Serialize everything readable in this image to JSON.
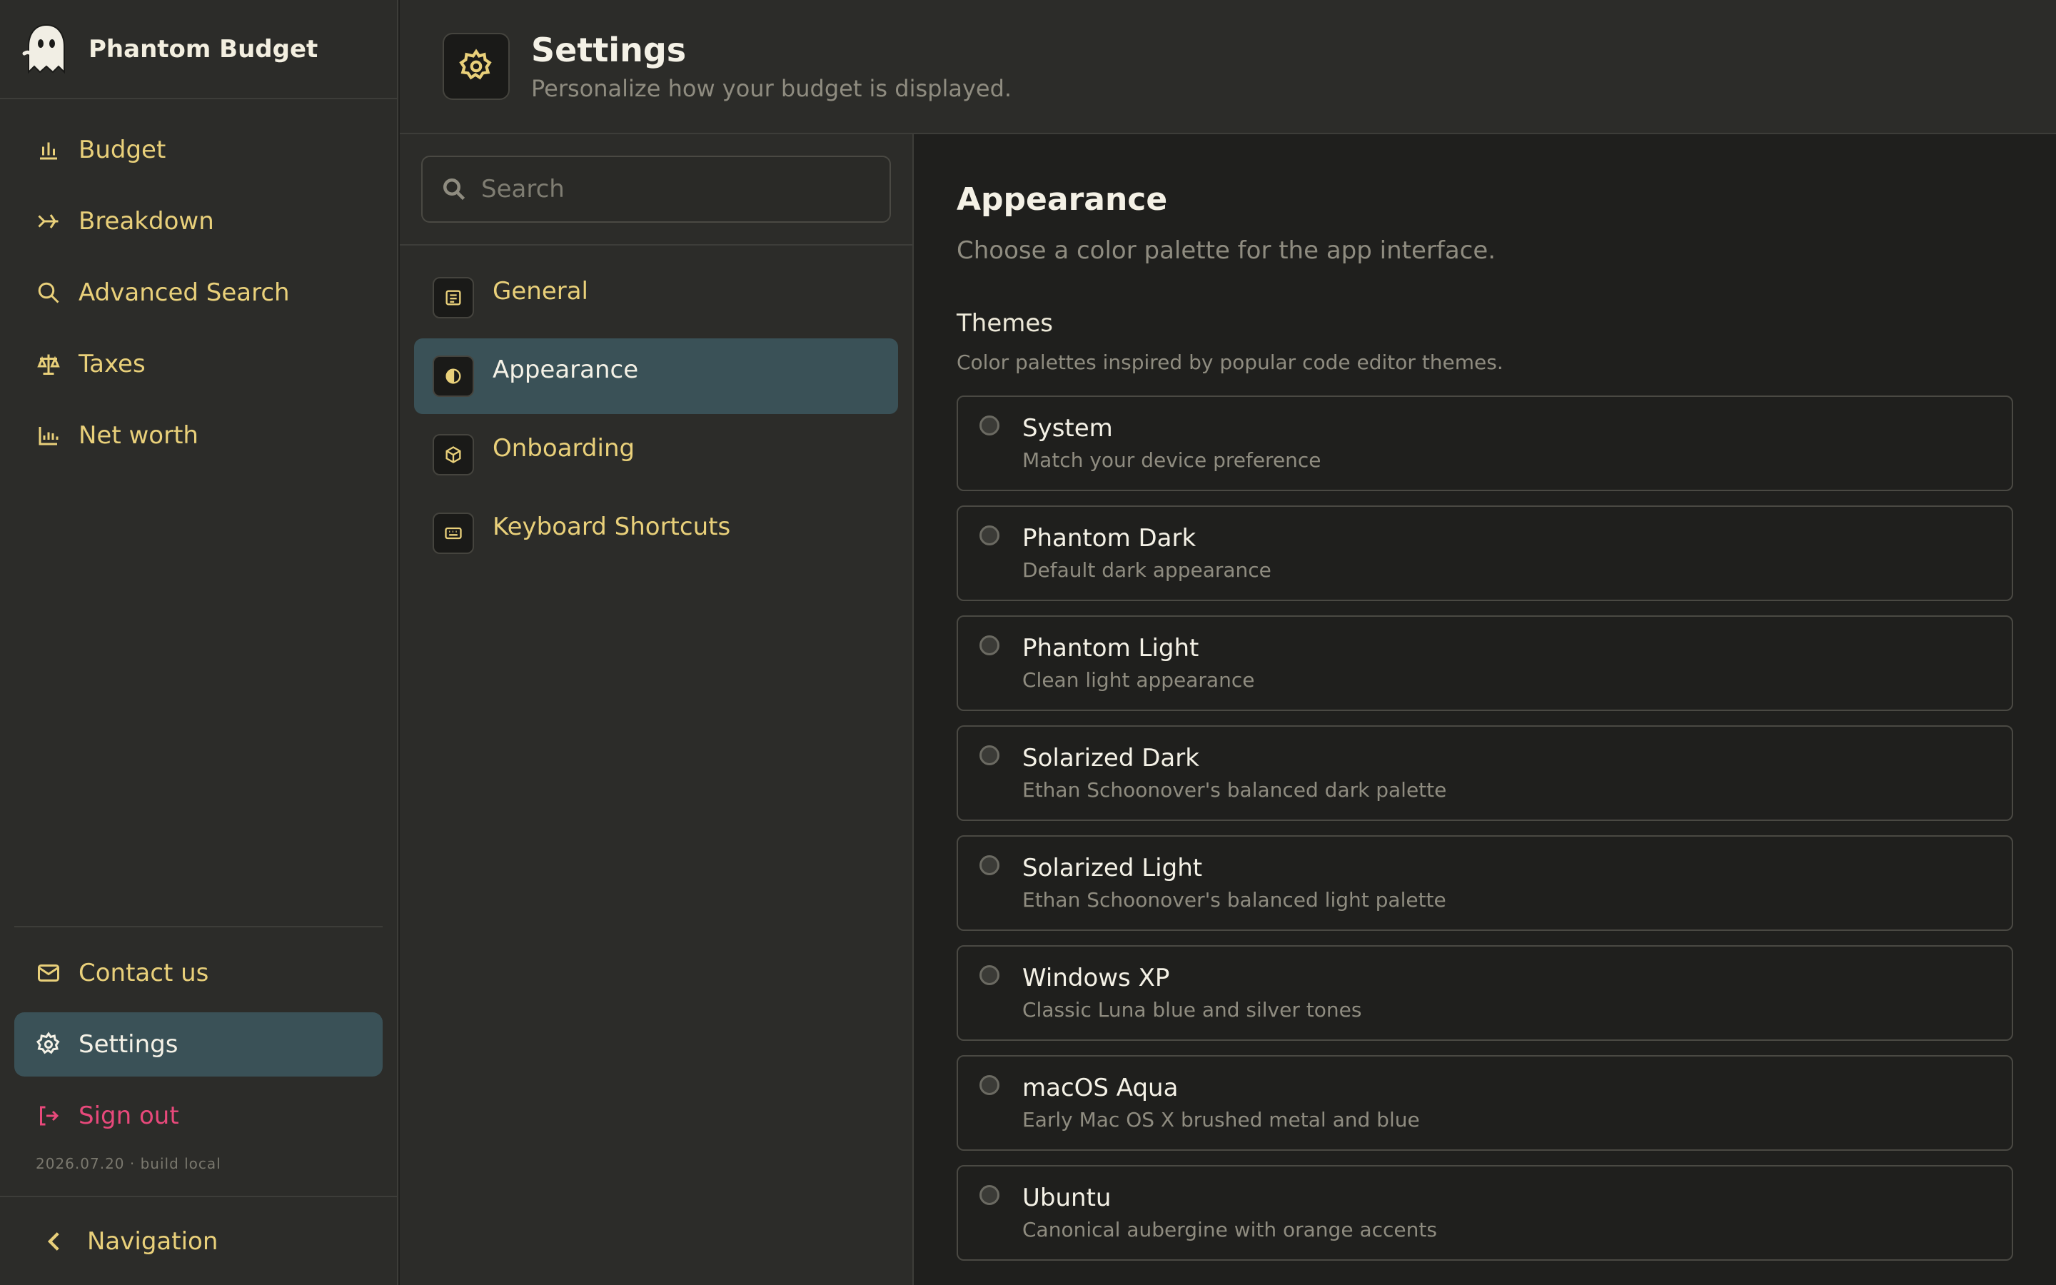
{
  "app": {
    "name": "Phantom Budget"
  },
  "sidebar": {
    "nav": [
      {
        "label": "Budget",
        "icon": "bar-chart-icon"
      },
      {
        "label": "Breakdown",
        "icon": "split-arrows-icon"
      },
      {
        "label": "Advanced Search",
        "icon": "search-icon"
      },
      {
        "label": "Taxes",
        "icon": "scale-icon"
      },
      {
        "label": "Net worth",
        "icon": "line-chart-icon"
      }
    ],
    "bottom": [
      {
        "label": "Contact us",
        "icon": "mail-icon"
      },
      {
        "label": "Settings",
        "icon": "gear-icon",
        "active": true
      },
      {
        "label": "Sign out",
        "icon": "sign-out-icon"
      }
    ],
    "build": "2026.07.20 · build local",
    "footer_label": "Navigation"
  },
  "header": {
    "title": "Settings",
    "subtitle": "Personalize how your budget is displayed."
  },
  "categories": {
    "search_placeholder": "Search",
    "items": [
      {
        "label": "General",
        "icon": "document-icon"
      },
      {
        "label": "Appearance",
        "icon": "half-circle-icon",
        "active": true
      },
      {
        "label": "Onboarding",
        "icon": "box-icon"
      },
      {
        "label": "Keyboard Shortcuts",
        "icon": "keyboard-icon"
      }
    ]
  },
  "appearance": {
    "title": "Appearance",
    "subtitle": "Choose a color palette for the app interface.",
    "themes_title": "Themes",
    "themes_subtitle": "Color palettes inspired by popular code editor themes.",
    "themes": [
      {
        "name": "System",
        "desc": "Match your device preference"
      },
      {
        "name": "Phantom Dark",
        "desc": "Default dark appearance"
      },
      {
        "name": "Phantom Light",
        "desc": "Clean light appearance"
      },
      {
        "name": "Solarized Dark",
        "desc": "Ethan Schoonover's balanced dark palette"
      },
      {
        "name": "Solarized Light",
        "desc": "Ethan Schoonover's balanced light palette"
      },
      {
        "name": "Windows XP",
        "desc": "Classic Luna blue and silver tones"
      },
      {
        "name": "macOS Aqua",
        "desc": "Early Mac OS X brushed metal and blue"
      },
      {
        "name": "Ubuntu",
        "desc": "Canonical aubergine with orange accents"
      }
    ]
  },
  "colors": {
    "accent": "#e9d07a",
    "active_bg": "#3a5157",
    "danger": "#e8497b",
    "panel": "#2c2c29",
    "content_bg": "#1f1f1d"
  }
}
